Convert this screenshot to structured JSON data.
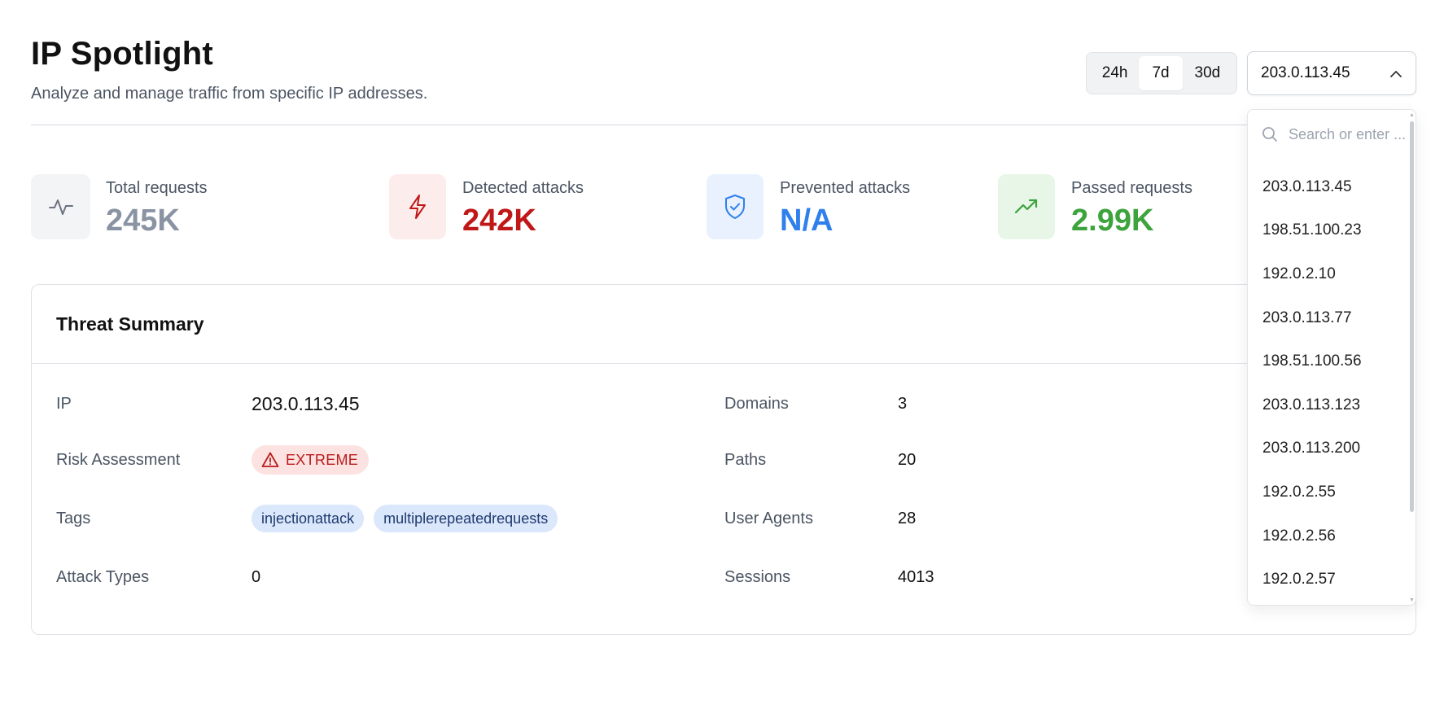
{
  "header": {
    "title": "IP Spotlight",
    "subtitle": "Analyze and manage traffic from specific IP addresses."
  },
  "time_range": {
    "options": [
      "24h",
      "7d",
      "30d"
    ],
    "selected": "7d"
  },
  "ip_select": {
    "value": "203.0.113.45",
    "expanded": true,
    "search_placeholder": "Search or enter ...",
    "options": [
      "203.0.113.45",
      "198.51.100.23",
      "192.0.2.10",
      "203.0.113.77",
      "198.51.100.56",
      "203.0.113.123",
      "203.0.113.200",
      "192.0.2.55",
      "192.0.2.56",
      "192.0.2.57"
    ]
  },
  "stats": [
    {
      "label": "Total requests",
      "value": "245K",
      "icon": "activity-icon",
      "color": "#8a93a3",
      "bg": "#f3f4f6"
    },
    {
      "label": "Detected attacks",
      "value": "242K",
      "icon": "lightning-icon",
      "color": "#c01818",
      "bg": "#fdecec"
    },
    {
      "label": "Prevented attacks",
      "value": "N/A",
      "icon": "shield-check-icon",
      "color": "#2f80ed",
      "bg": "#e8f1fd"
    },
    {
      "label": "Passed requests",
      "value": "2.99K",
      "icon": "trending-up-icon",
      "color": "#3da33d",
      "bg": "#e8f6e8"
    }
  ],
  "threat_summary": {
    "title": "Threat Summary",
    "left": {
      "ip_label": "IP",
      "ip_value": "203.0.113.45",
      "risk_label": "Risk Assessment",
      "risk_value": "EXTREME",
      "tags_label": "Tags",
      "tags": [
        "injectionattack",
        "multiplerepeatedrequests"
      ],
      "attack_types_label": "Attack Types",
      "attack_types_value": "0"
    },
    "right": {
      "domains_label": "Domains",
      "domains_value": "3",
      "paths_label": "Paths",
      "paths_value": "20",
      "user_agents_label": "User Agents",
      "user_agents_value": "28",
      "sessions_label": "Sessions",
      "sessions_value": "4013"
    }
  },
  "colors": {
    "risk_badge_bg": "#fde2e2",
    "risk_badge_text": "#b91c1c",
    "tag_bg": "#dbe7fb",
    "tag_text": "#1e3a6e"
  }
}
